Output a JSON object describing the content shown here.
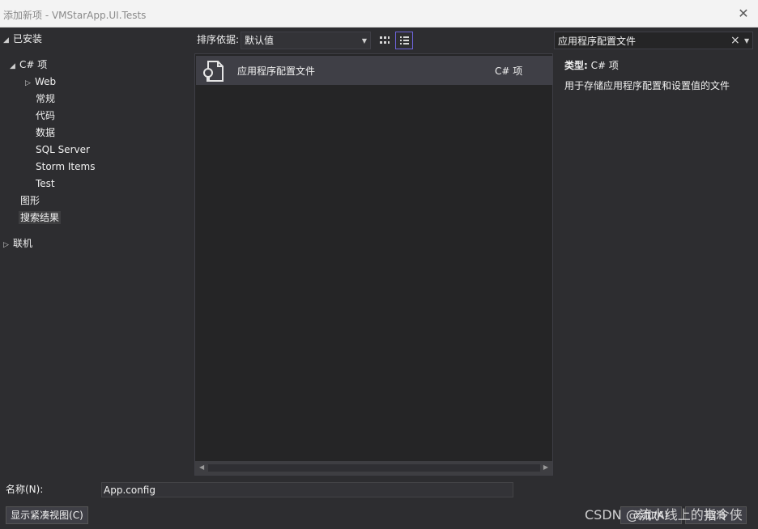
{
  "window": {
    "title": "添加新项 - VMStarApp.UI.Tests",
    "close_icon": "close-icon"
  },
  "tree": {
    "installed": "已安装",
    "csharp": "C# 项",
    "web": "Web",
    "general": "常规",
    "code": "代码",
    "data": "数据",
    "sql_server": "SQL Server",
    "storm_items": "Storm Items",
    "test": "Test",
    "graphics": "图形",
    "search_results": "搜索结果",
    "online": "联机"
  },
  "toolbar": {
    "sort_label": "排序依据:",
    "sort_value": "默认值",
    "grid_view_icon": "grid-view-icon",
    "list_view_icon": "list-view-icon"
  },
  "search": {
    "value": "应用程序配置文件"
  },
  "templates": [
    {
      "name": "应用程序配置文件",
      "language": "C# 项",
      "icon": "config-file-icon"
    }
  ],
  "details": {
    "type_label": "类型:",
    "type_value": "C# 项",
    "description": "用于存储应用程序配置和设置值的文件"
  },
  "footer": {
    "name_label": "名称(N):",
    "name_value": "App.config",
    "compact_view_label": "显示紧凑视图(C)",
    "add_label": "添加(A)",
    "cancel_label": "取消",
    "watermark": "CSDN @流水线上的指令侠"
  },
  "colors": {
    "accent": "#6d63d8",
    "selected_row": "#3f3f46",
    "background": "#2d2d30"
  }
}
